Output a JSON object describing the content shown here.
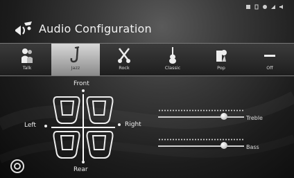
{
  "header": {
    "title": "Audio Configuration"
  },
  "presets": [
    {
      "label": "Talk",
      "icon": "talk-icon",
      "active": false
    },
    {
      "label": "Jazz",
      "icon": "saxophone-icon",
      "active": true
    },
    {
      "label": "Rock",
      "icon": "guitars-icon",
      "active": false
    },
    {
      "label": "Classic",
      "icon": "violin-icon",
      "active": false
    },
    {
      "label": "Pop",
      "icon": "pop-icon",
      "active": false
    },
    {
      "label": "Off",
      "icon": "dash-icon",
      "active": false
    }
  ],
  "balance": {
    "front": "Front",
    "rear": "Rear",
    "left": "Left",
    "right": "Right"
  },
  "tone": {
    "treble": {
      "label": "Treble",
      "level": 0.79
    },
    "bass": {
      "label": "Bass",
      "level": 0.79
    }
  }
}
